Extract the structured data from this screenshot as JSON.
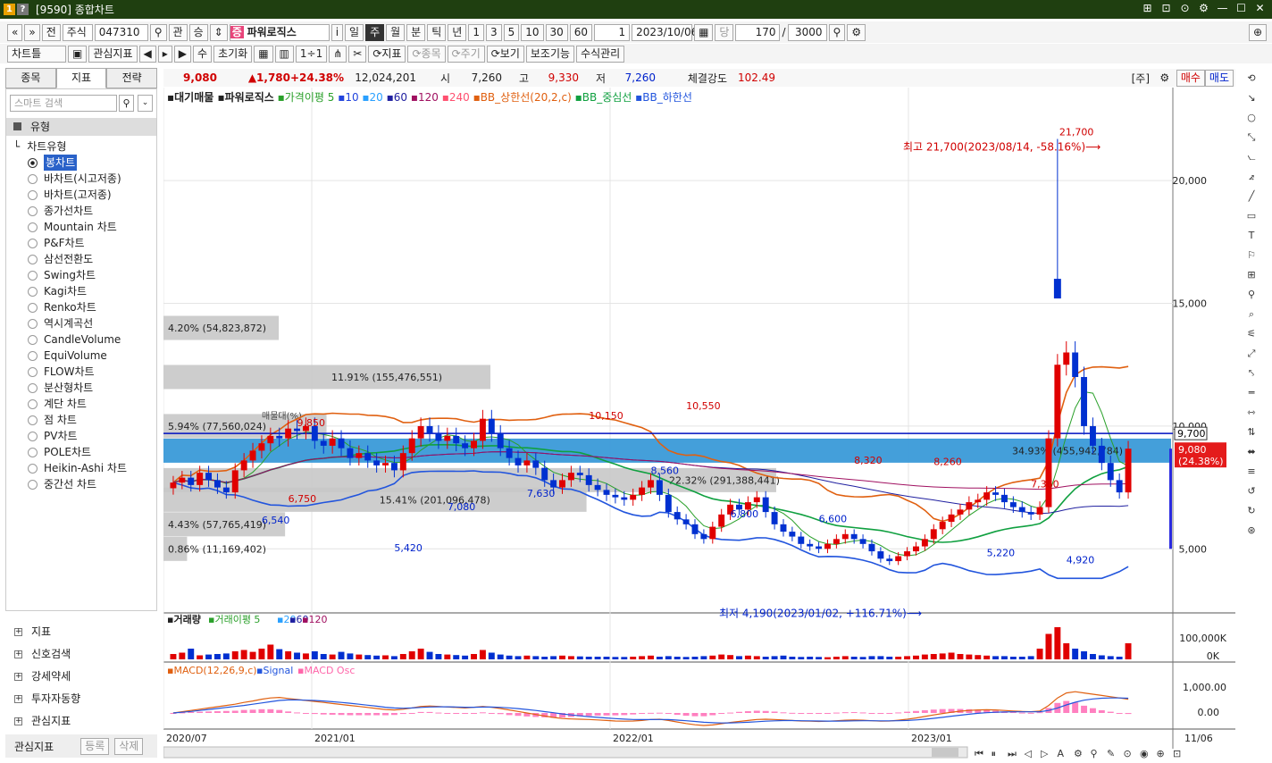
{
  "window": {
    "badge1": "1",
    "badge2": "?",
    "title": "[9590] 종합차트",
    "ctrl": [
      "⊞",
      "⊡",
      "⊙",
      "⚙",
      "—",
      "☐",
      "✕"
    ]
  },
  "toolbar1": {
    "nav": [
      "«",
      "»",
      "전"
    ],
    "market": "주식",
    "code": "047310",
    "search_icon": "⚲",
    "gwan": "관",
    "jeung": "승",
    "spin": "⇕",
    "stock_badge": "증",
    "stock_name": "파워로직스",
    "info": "i",
    "periods": [
      "일",
      "주",
      "월",
      "분",
      "틱",
      "년"
    ],
    "period_selected": "주",
    "intervals": [
      "1",
      "3",
      "5",
      "10",
      "30",
      "60"
    ],
    "unit": "1",
    "date": "2023/10/06",
    "calendar_icon": "▦",
    "count_label": "당",
    "count": "170",
    "slash": "/",
    "total": "3000",
    "zoom_icon": "⚲",
    "settings_icon": "⚙",
    "pin_icon": "⊕"
  },
  "toolbar2": {
    "chart_type": "차트틀",
    "save_icon": "▣",
    "fav_indicator": "관심지표",
    "arrows": [
      "◀",
      "▸",
      "▶"
    ],
    "su": "수",
    "reset": "초기화",
    "grid_icons": [
      "▦",
      "▥",
      "1÷1",
      "⋔",
      "✂"
    ],
    "indicator": "⟳지표",
    "item": "⟳종목",
    "cycle": "⟳주기",
    "view": "⟳보기",
    "aux": "보조기능",
    "formula": "수식관리"
  },
  "left": {
    "tabs": [
      "종목",
      "지표",
      "전략"
    ],
    "tab_selected": "지표",
    "search_placeholder": "스마트 검색",
    "search_icon": "⚲",
    "sort_icon": "⌄",
    "group": "유형",
    "subhead": "차트유형",
    "types": [
      "봉차트",
      "바차트(시고저종)",
      "바차트(고저종)",
      "종가선차트",
      "Mountain 차트",
      "P&F차트",
      "삼선전환도",
      "Swing차트",
      "Kagi차트",
      "Renko차트",
      "역시계곡선",
      "CandleVolume",
      "EquiVolume",
      "FLOW차트",
      "분산형차트",
      "계단 차트",
      "점 차트",
      "PV차트",
      "POLE차트",
      "Heikin-Ashi 차트",
      "중간선 차트"
    ],
    "type_selected": "봉차트",
    "bottom": [
      "지표",
      "신호검색",
      "강세약세",
      "투자자동향",
      "관심지표"
    ],
    "fav_label": "관심지표",
    "fav_add": "등록",
    "fav_del": "삭제"
  },
  "quote": {
    "price": "9,080",
    "change": "▲1,780",
    "rate": "+24.38%",
    "volume": "12,024,201",
    "open_label": "시",
    "open": "7,260",
    "high_label": "고",
    "high": "9,330",
    "low_label": "저",
    "low": "7,260",
    "strength_label": "체결강도",
    "strength": "102.49",
    "ju": "[주]",
    "buy": "매수",
    "sell": "매도"
  },
  "legend": {
    "items": [
      "대기매물",
      "파워로직스",
      "가격이평 5",
      "10",
      "20",
      "60",
      "120",
      "240",
      "BB_상한선(20,2,c)",
      "BB_중심선",
      "BB_하한선"
    ],
    "colors": [
      "#222222",
      "#222222",
      "#2aa02a",
      "#2244dd",
      "#2aa0ff",
      "#2020a0",
      "#a01060",
      "#ff5070",
      "#e06010",
      "#10a040",
      "#2255dd"
    ]
  },
  "chart_data": [
    {
      "type": "candlestick",
      "title": "파워로직스",
      "x_ticks": [
        "2020/07",
        "2021/01",
        "2022/01",
        "2023/01",
        "11/06"
      ],
      "y_ticks": [
        "5,000",
        "10,000",
        "15,000",
        "20,000"
      ],
      "ylim": [
        2500,
        23500
      ],
      "last_price": "9,080",
      "last_rate": "(24.38%)",
      "hline_value": "9,700",
      "annotations": [
        {
          "text": "최고 21,700(2023/08/14, -58.16%)⟶",
          "value": 21700
        },
        {
          "text": "최저 4,190(2023/01/02, +116.71%)⟶",
          "value": 4190
        }
      ],
      "point_labels": [
        {
          "text": "21,700",
          "value": 21700,
          "kind": "high"
        },
        {
          "text": "10,150",
          "value": 10150,
          "kind": "high"
        },
        {
          "text": "10,550",
          "value": 10550,
          "kind": "high"
        },
        {
          "text": "9,850",
          "value": 9850,
          "kind": "high"
        },
        {
          "text": "8,320",
          "value": 8320,
          "kind": "high"
        },
        {
          "text": "8,260",
          "value": 8260,
          "kind": "high"
        },
        {
          "text": "7,360",
          "value": 7360,
          "kind": "high"
        },
        {
          "text": "6,750",
          "value": 6750,
          "kind": "high"
        },
        {
          "text": "8,560",
          "value": 8560,
          "kind": "low"
        },
        {
          "text": "7,630",
          "value": 7630,
          "kind": "low"
        },
        {
          "text": "6,540",
          "value": 6540,
          "kind": "low"
        },
        {
          "text": "6,800",
          "value": 6800,
          "kind": "low"
        },
        {
          "text": "6,600",
          "value": 6600,
          "kind": "low"
        },
        {
          "text": "5,220",
          "value": 5220,
          "kind": "low"
        },
        {
          "text": "4,920",
          "value": 4920,
          "kind": "low"
        },
        {
          "text": "5,420",
          "value": 5420,
          "kind": "low"
        },
        {
          "text": "7,080",
          "value": 7080,
          "kind": "low"
        }
      ],
      "volume_profile": [
        {
          "label": "4.20% (54,823,872)",
          "value": 14000,
          "pct": 4.2
        },
        {
          "label": "11.91% (155,476,551)",
          "value": 12000,
          "pct": 11.91
        },
        {
          "label": "5.94% (77,560,024)",
          "value": 10000,
          "pct": 5.94
        },
        {
          "label": "34.93% (455,942,784)",
          "value": 9000,
          "pct": 34.93
        },
        {
          "label": "22.32% (291,388,441)",
          "value": 7800,
          "pct": 22.32
        },
        {
          "label": "15.41% (201,096,478)",
          "value": 7000,
          "pct": 15.41
        },
        {
          "label": "4.43% (57,765,419)",
          "value": 6000,
          "pct": 4.43
        },
        {
          "label": "0.86% (11,169,402)",
          "value": 5000,
          "pct": 0.86
        }
      ],
      "profile_note": "매물대(%)",
      "series_close": [
        7700,
        7900,
        7600,
        8100,
        7800,
        7500,
        7300,
        8200,
        8600,
        9000,
        9300,
        9600,
        9500,
        9900,
        9800,
        10000,
        9400,
        9200,
        9500,
        9100,
        8700,
        8900,
        8600,
        8400,
        8500,
        8200,
        8900,
        9500,
        10000,
        9700,
        9400,
        9600,
        9300,
        9100,
        9400,
        10300,
        9700,
        9100,
        8700,
        8400,
        8600,
        8300,
        7800,
        7500,
        7800,
        8100,
        8000,
        7600,
        7400,
        7200,
        7100,
        7000,
        7200,
        7500,
        7800,
        7200,
        6500,
        6200,
        6000,
        5600,
        5400,
        5900,
        6400,
        6800,
        6600,
        6900,
        7100,
        6500,
        6000,
        5700,
        5500,
        5200,
        5100,
        5000,
        5200,
        5400,
        5600,
        5400,
        5200,
        4900,
        4600,
        4500,
        4700,
        4900,
        5100,
        5400,
        5800,
        6100,
        6400,
        6600,
        6900,
        7000,
        7300,
        7200,
        6900,
        6700,
        6500,
        6400,
        6700,
        9500,
        12500,
        13000,
        12000,
        10000,
        9200,
        8500,
        7800,
        7300,
        9080
      ],
      "ma5": "5",
      "ma20": "20",
      "ma60": "60"
    },
    {
      "type": "bar",
      "title": "거래량",
      "legend": [
        "거래량",
        "거래이평 5",
        "20",
        "60",
        "120"
      ],
      "y_ticks": [
        "100,000K",
        "0K"
      ],
      "values": [
        20,
        25,
        40,
        15,
        18,
        20,
        22,
        30,
        35,
        28,
        40,
        55,
        38,
        30,
        25,
        22,
        30,
        20,
        18,
        28,
        22,
        18,
        16,
        14,
        15,
        12,
        20,
        30,
        40,
        28,
        20,
        18,
        16,
        14,
        20,
        35,
        25,
        18,
        14,
        12,
        14,
        12,
        10,
        12,
        14,
        12,
        11,
        10,
        10,
        10,
        9,
        9,
        10,
        12,
        14,
        10,
        12,
        10,
        9,
        10,
        12,
        14,
        18,
        16,
        12,
        14,
        12,
        10,
        12,
        14,
        10,
        9,
        10,
        9,
        8,
        10,
        12,
        10,
        9,
        12,
        12,
        10,
        10,
        12,
        14,
        18,
        20,
        22,
        25,
        20,
        18,
        16,
        14,
        12,
        12,
        10,
        10,
        12,
        40,
        95,
        120,
        60,
        40,
        30,
        20,
        15,
        12,
        10,
        60
      ]
    },
    {
      "type": "line",
      "title": "MACD",
      "legend": [
        "MACD(12,26,9,c)",
        "Signal",
        "MACD Osc"
      ],
      "y_ticks": [
        "1,000.00",
        "0.00"
      ],
      "macd": [
        0,
        50,
        100,
        150,
        200,
        250,
        300,
        350,
        420,
        480,
        550,
        600,
        620,
        580,
        540,
        500,
        460,
        420,
        380,
        340,
        300,
        260,
        220,
        180,
        140,
        120,
        150,
        200,
        260,
        280,
        260,
        240,
        220,
        200,
        230,
        260,
        230,
        180,
        120,
        60,
        0,
        -60,
        -120,
        -180,
        -220,
        -240,
        -250,
        -260,
        -280,
        -300,
        -320,
        -330,
        -320,
        -300,
        -260,
        -250,
        -300,
        -360,
        -420,
        -470,
        -500,
        -480,
        -430,
        -380,
        -340,
        -300,
        -260,
        -250,
        -260,
        -280,
        -300,
        -320,
        -330,
        -340,
        -330,
        -310,
        -290,
        -280,
        -290,
        -310,
        -330,
        -320,
        -290,
        -250,
        -200,
        -140,
        -80,
        -20,
        30,
        70,
        100,
        120,
        130,
        120,
        100,
        80,
        60,
        50,
        80,
        300,
        600,
        800,
        850,
        800,
        750,
        700,
        650,
        600,
        550
      ],
      "signal": [
        0,
        30,
        60,
        100,
        140,
        180,
        220,
        260,
        300,
        350,
        400,
        450,
        500,
        520,
        520,
        510,
        500,
        480,
        450,
        420,
        390,
        350,
        310,
        270,
        230,
        200,
        190,
        200,
        220,
        240,
        245,
        245,
        240,
        230,
        230,
        235,
        235,
        225,
        205,
        175,
        140,
        100,
        55,
        10,
        -40,
        -80,
        -115,
        -145,
        -175,
        -200,
        -225,
        -245,
        -260,
        -265,
        -265,
        -260,
        -265,
        -285,
        -310,
        -340,
        -370,
        -390,
        -400,
        -395,
        -385,
        -370,
        -350,
        -330,
        -315,
        -305,
        -305,
        -310,
        -315,
        -320,
        -325,
        -325,
        -320,
        -315,
        -310,
        -310,
        -315,
        -315,
        -310,
        -300,
        -280,
        -250,
        -215,
        -175,
        -130,
        -90,
        -50,
        -15,
        10,
        30,
        40,
        45,
        45,
        45,
        50,
        100,
        200,
        320,
        430,
        510,
        560,
        590,
        600,
        600,
        590
      ]
    }
  ],
  "right_tools": [
    "⟲",
    "↘",
    "○",
    "⤡",
    "⦦",
    "⦨",
    "╱",
    "▭",
    "T",
    "⚐",
    "⊞",
    "⚲",
    "⌕",
    "⚟",
    "⤢",
    "⤣",
    "═",
    "⇿",
    "⇅",
    "⬌",
    "≡",
    "↺",
    "↻",
    "⊛"
  ],
  "scroll_icons": [
    "⏮",
    "⏸",
    "⏭",
    "◁",
    "▷",
    "A",
    "⚙",
    "⚲",
    "✎",
    "⊙",
    "◉",
    "⊕",
    "⊡"
  ]
}
